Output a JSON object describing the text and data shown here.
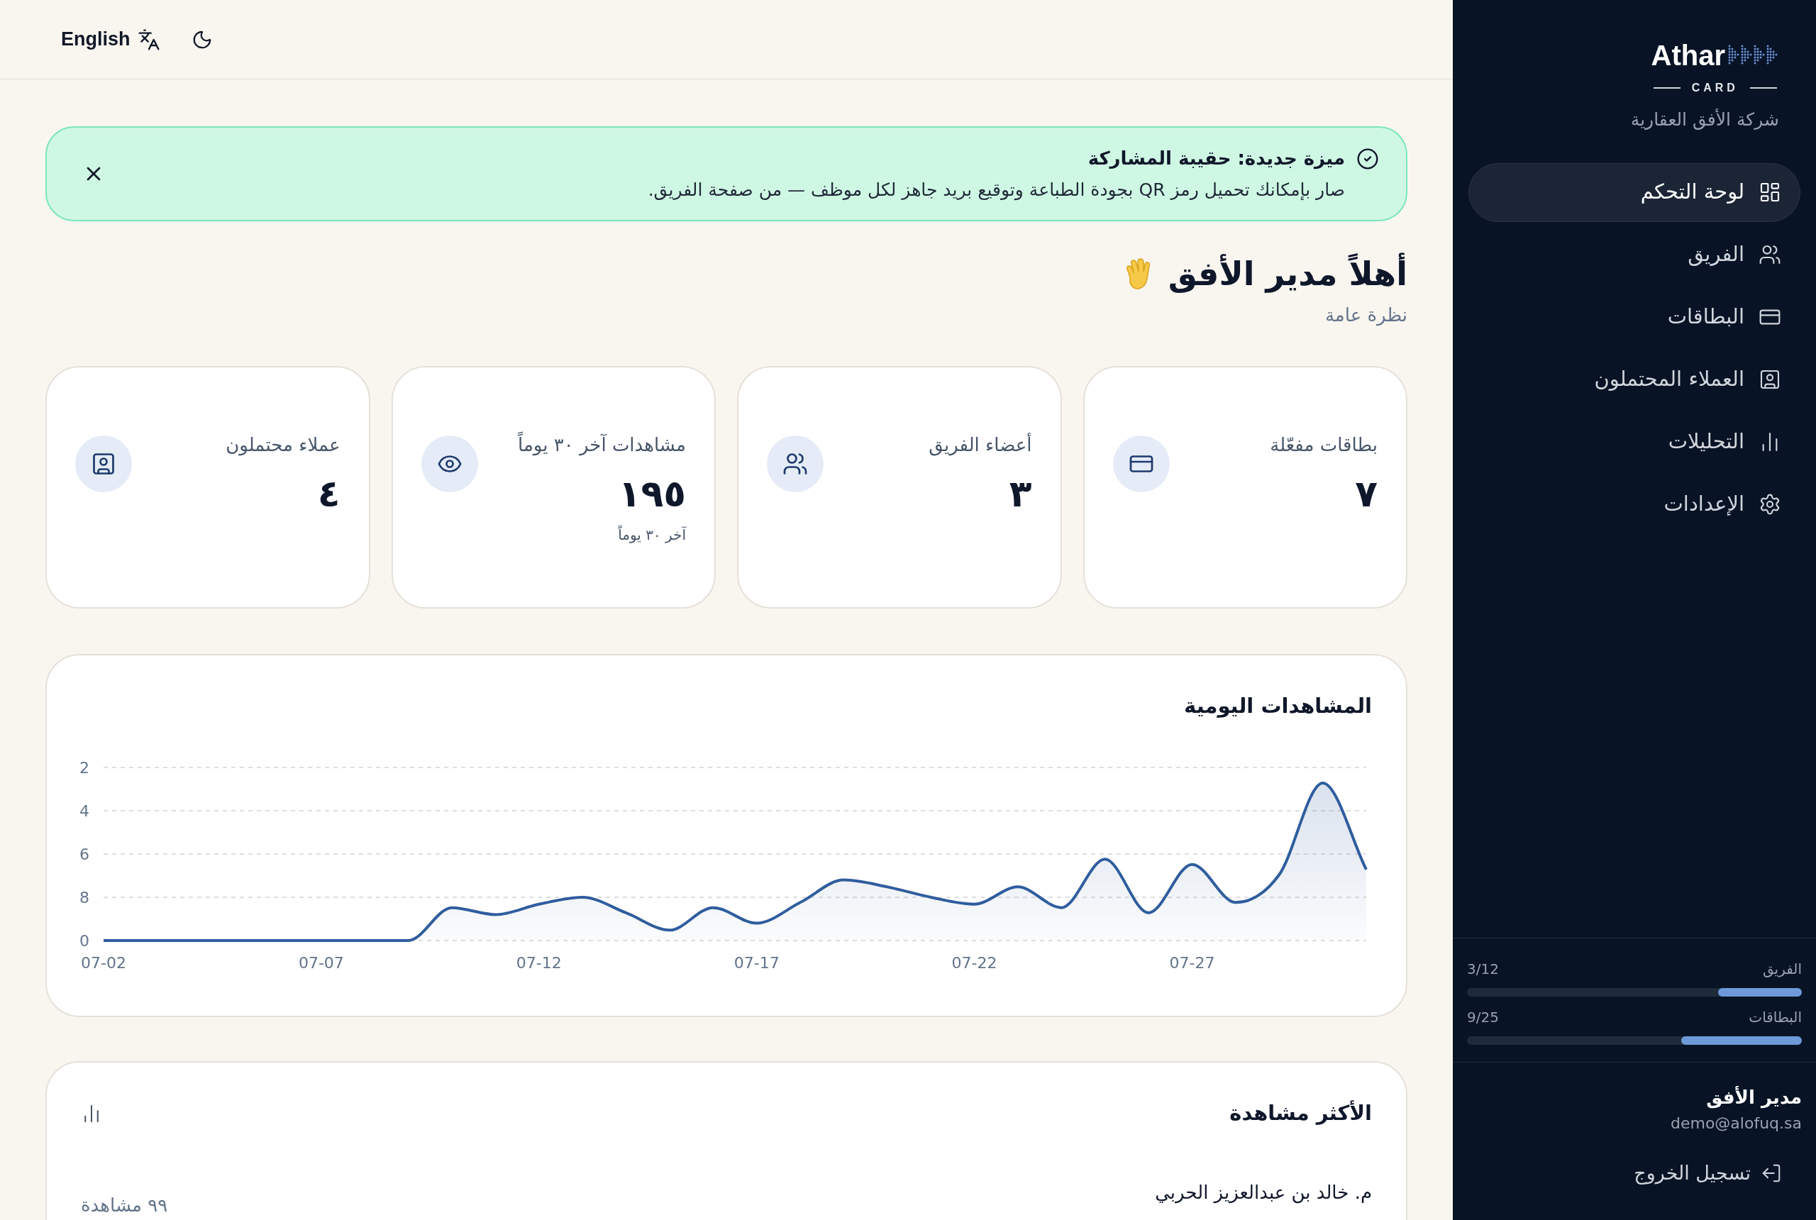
{
  "topbar": {
    "language": "English"
  },
  "banner": {
    "title": "ميزة جديدة: حقيبة المشاركة",
    "text": "صار بإمكانك تحميل رمز QR بجودة الطباعة وتوقيع بريد جاهز لكل موظف — من صفحة الفريق."
  },
  "greeting": {
    "title": "أهلاً مدير الأفق",
    "subtitle": "نظرة عامة"
  },
  "stats": [
    {
      "label": "بطاقات مفعّلة",
      "value": "٧"
    },
    {
      "label": "أعضاء الفريق",
      "value": "٣"
    },
    {
      "label": "مشاهدات آخر ٣٠ يوماً",
      "value": "١٩٥",
      "note": "آخر ٣٠ يوماً"
    },
    {
      "label": "عملاء محتملون",
      "value": "٤"
    }
  ],
  "daily_views": {
    "title": "المشاهدات اليومية",
    "x_axis_labels": [
      "07-27",
      "07-22",
      "07-17",
      "07-12",
      "07-07",
      "07-02"
    ],
    "y_axis_labels": [
      "2",
      "4",
      "6",
      "8",
      "0"
    ]
  },
  "most_viewed": {
    "title": "الأكثر مشاهدة",
    "rows": [
      {
        "name": "م. خالد بن عبدالعزيز الحربي",
        "views": "٩٩ مشاهدة"
      }
    ]
  },
  "sidebar": {
    "logo": "Athar",
    "logo_sub": "CARD",
    "company": "شركة الأفق العقارية",
    "items": [
      {
        "label": "لوحة التحكم",
        "selected": true
      },
      {
        "label": "الفريق",
        "selected": false
      },
      {
        "label": "البطاقات",
        "selected": false
      },
      {
        "label": "العملاء المحتملون",
        "selected": false
      },
      {
        "label": "التحليلات",
        "selected": false
      },
      {
        "label": "الإعدادات",
        "selected": false
      }
    ],
    "usage": [
      {
        "label": "الفريق",
        "reading": "3/12",
        "level": 0.25
      },
      {
        "label": "البطاقات",
        "reading": "9/25",
        "level": 0.36
      }
    ],
    "user": {
      "name": "مدير الأفق",
      "email": "demo@alofuq.sa"
    },
    "logout": "تسجيل الخروج"
  }
}
